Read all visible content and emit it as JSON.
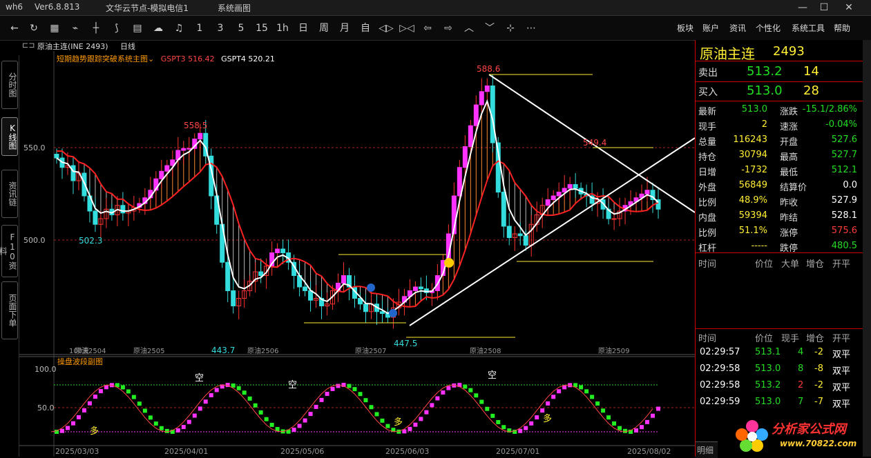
{
  "window": {
    "app": "wh6",
    "version": "Ver6.8.813",
    "server": "文华云节点-模拟电信1",
    "system_tool": "系统画图"
  },
  "toolbar": {
    "periods": [
      "1",
      "3",
      "5",
      "15",
      "1h",
      "日",
      "周",
      "月",
      "自"
    ],
    "menus": [
      "板块",
      "账户",
      "资讯",
      "个性化",
      "系统工具",
      "帮助"
    ]
  },
  "left_tabs": [
    "分时图",
    "K线图",
    "资讯链",
    "F10资料",
    "页面下单"
  ],
  "chart_header": {
    "symbol": "原油主连(INE 2493)",
    "period": "日线",
    "indicator_name": "短期趋势跟踪突破系统主图",
    "gspt3": "GSPT3 516.42",
    "gspt4": "GSPT4 520.21"
  },
  "chart_data": [
    {
      "type": "candlestick",
      "title": "原油主连 日线",
      "y_ticks": [
        "550.0",
        "500.0"
      ],
      "ylim": [
        440,
        592
      ],
      "annotations": [
        "588.6",
        "558.5",
        "549.4",
        "502.3",
        "443.7",
        "447.5"
      ],
      "contract_labels": [
        "原油2504",
        "原油2505",
        "原油2506",
        "原油2507",
        "原油2508",
        "原油2509"
      ],
      "scale_label": "100天",
      "candles_close": [
        540,
        535,
        536,
        528,
        532,
        520,
        512,
        505,
        508,
        513,
        510,
        515,
        511,
        512,
        514,
        516,
        519,
        523,
        529,
        533,
        536,
        539,
        544,
        545,
        545,
        550,
        553,
        541,
        520,
        505,
        485,
        470,
        462,
        466,
        470,
        475,
        480,
        478,
        483,
        490,
        492,
        490,
        485,
        478,
        472,
        470,
        465,
        466,
        462,
        463,
        470,
        474,
        478,
        472,
        466,
        463,
        459,
        463,
        459,
        458,
        456,
        461,
        464,
        467,
        470,
        472,
        471,
        469,
        470,
        478,
        486,
        500,
        520,
        535,
        546,
        557,
        568,
        575,
        578,
        548,
        522,
        504,
        498,
        500,
        499,
        494,
        505,
        510,
        515,
        518,
        520,
        522,
        524,
        526,
        524,
        521,
        520,
        516,
        518,
        513,
        508,
        508,
        512,
        515,
        517,
        519,
        521,
        523,
        518,
        513
      ]
    },
    {
      "type": "line",
      "title": "操盘波段副图",
      "y_ticks": [
        "100.0",
        "50.0"
      ],
      "ylim": [
        0,
        100
      ],
      "signals": [
        "多",
        "空",
        "空",
        "多",
        "空",
        "多"
      ],
      "x_date_labels": [
        "2025/03/03",
        "2025/04/01",
        "2025/05/06",
        "2025/06/03",
        "2025/07/01",
        "2025/08/02"
      ]
    }
  ],
  "quote": {
    "name": "原油主连",
    "code": "2493",
    "sell_label": "卖出",
    "sell_price": "513.2",
    "sell_qty": "14",
    "buy_label": "买入",
    "buy_price": "513.0",
    "buy_qty": "28",
    "rows": [
      {
        "l1": "最新",
        "v1": "513.0",
        "c1": "grn",
        "l2": "涨跌",
        "v2": "-15.1/2.86%",
        "c2": "grn"
      },
      {
        "l1": "现手",
        "v1": "2",
        "c1": "yel",
        "l2": "速涨",
        "v2": "-0.04%",
        "c2": "grn"
      },
      {
        "l1": "总量",
        "v1": "116243",
        "c1": "yel",
        "l2": "开盘",
        "v2": "527.6",
        "c2": "grn"
      },
      {
        "l1": "持仓",
        "v1": "30794",
        "c1": "yel",
        "l2": "最高",
        "v2": "527.7",
        "c2": "grn"
      },
      {
        "l1": "日增",
        "v1": "-1732",
        "c1": "yel",
        "l2": "最低",
        "v2": "512.1",
        "c2": "grn"
      },
      {
        "l1": "外盘",
        "v1": "56849",
        "c1": "yel",
        "l2": "结算价",
        "v2": "0.0",
        "c2": "wht"
      },
      {
        "l1": "比例",
        "v1": "48.9%",
        "c1": "yel",
        "l2": "昨收",
        "v2": "527.9",
        "c2": "wht"
      },
      {
        "l1": "内盘",
        "v1": "59394",
        "c1": "yel",
        "l2": "昨结",
        "v2": "528.1",
        "c2": "wht"
      },
      {
        "l1": "比例",
        "v1": "51.1%",
        "c1": "yel",
        "l2": "涨停",
        "v2": "575.6",
        "c2": "red"
      },
      {
        "l1": "杠杆",
        "v1": "-----",
        "c1": "yel",
        "l2": "跌停",
        "v2": "480.5",
        "c2": "grn"
      }
    ],
    "big_order_headers": [
      "时间",
      "价位",
      "大单",
      "增仓",
      "开平"
    ],
    "tick_headers": [
      "时间",
      "价位",
      "现手",
      "增仓",
      "开平"
    ],
    "ticks": [
      {
        "time": "02:29:57",
        "price": "513.1",
        "qty": "4",
        "inc": "-2",
        "oc": "双平",
        "pc": "grn",
        "qc": "grn"
      },
      {
        "time": "02:29:58",
        "price": "513.0",
        "qty": "8",
        "inc": "-8",
        "oc": "双平",
        "pc": "grn",
        "qc": "grn"
      },
      {
        "time": "02:29:58",
        "price": "513.2",
        "qty": "2",
        "inc": "-2",
        "oc": "双平",
        "pc": "grn",
        "qc": "red"
      },
      {
        "time": "02:29:59",
        "price": "513.0",
        "qty": "7",
        "inc": "-7",
        "oc": "双平",
        "pc": "grn",
        "qc": "grn"
      }
    ],
    "tab_label": "明细"
  },
  "watermark": {
    "text": "分析家公式网",
    "url": "www.70822.com"
  }
}
